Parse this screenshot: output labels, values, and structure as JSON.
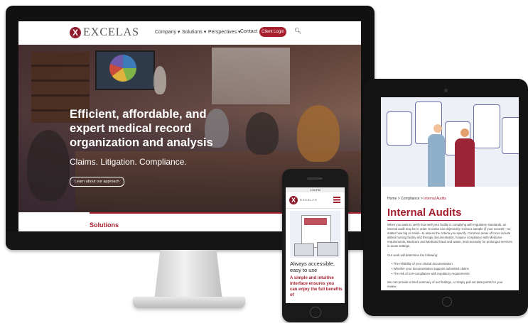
{
  "desktop": {
    "logo_text": "EXCELAS",
    "nav": {
      "company": "Company ▾",
      "solutions": "Solutions ▾",
      "perspectives": "Perspectives ▾",
      "contact": "Contact",
      "client_login": "Client Login"
    },
    "hero": {
      "headline": "Efficient, affordable, and expert medical record organization and analysis",
      "subline": "Claims. Litigation. Compliance.",
      "cta": "Learn about our approach"
    },
    "section_title": "Solutions"
  },
  "tablet": {
    "breadcrumb": {
      "home": "Home",
      "sep1": ">",
      "compliance": "Compliance",
      "sep2": ">",
      "current": "Internal Audits"
    },
    "title": "Internal Audits",
    "paragraph1": "When you want to verify how well your facility is complying with regulatory standards, an internal audit may be in order. Excelas can objectively review a sample of your records—no matter how big or small—to assess the criteria you specify. Common areas of focus include skilled nursing facility and therapy documentation, hospice compliance with Medicare requirements, Medicare and Medicaid fraud and waste, and necessity for prolonged services in acute settings.",
    "paragraph2": "Our work will determine the following:",
    "bullets": [
      "The reliability of your clinical documentation",
      "Whether your documentation supports submitted claims",
      "The risk of non-compliance with regulatory requirements"
    ],
    "paragraph3": "We can provide a brief summary of our findings, or simply pull out data points for your review"
  },
  "phone": {
    "status_time": "1:55 PM",
    "logo_text": "EXCELAS",
    "headline": "Always accessible, easy to use",
    "subheadline": "A simple and intuitive interface ensures you can enjoy the full benefits of"
  },
  "colors": {
    "brand": "#a51f2f",
    "brand_dark": "#8f1c2c"
  }
}
